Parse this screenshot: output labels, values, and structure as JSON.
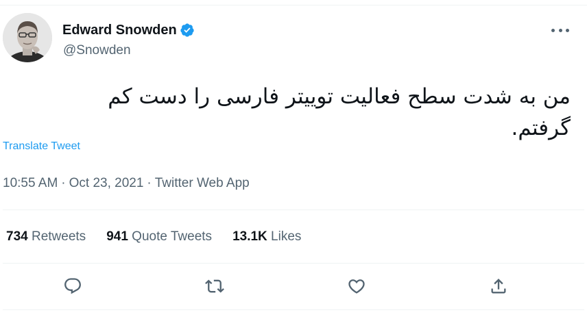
{
  "author": {
    "display_name": "Edward Snowden",
    "handle": "@Snowden",
    "verified": true,
    "avatar_icon": "avatar-photo"
  },
  "tweet": {
    "text": "من به شدت سطح فعالیت توییتر فارسی را دست کم گرفتم.",
    "translate_label": "Translate Tweet"
  },
  "meta": {
    "time": "10:55 AM",
    "separator": "·",
    "date": "Oct 23, 2021",
    "source": "Twitter Web App"
  },
  "stats": {
    "retweets_count": "734",
    "retweets_label": "Retweets",
    "quote_count": "941",
    "quote_label": "Quote Tweets",
    "likes_count": "13.1K",
    "likes_label": "Likes"
  },
  "actions": [
    "reply-icon",
    "retweet-icon",
    "like-icon",
    "share-icon"
  ],
  "colors": {
    "accent": "#1d9bf0",
    "text_primary": "#0f1419",
    "text_secondary": "#536471",
    "divider": "#eff3f4"
  }
}
